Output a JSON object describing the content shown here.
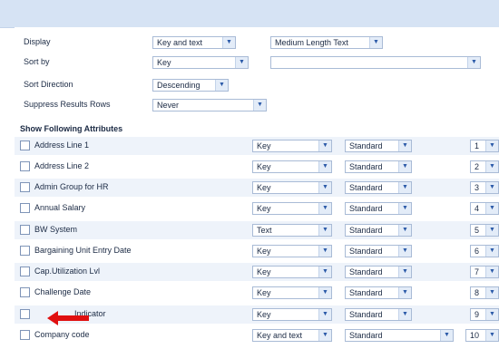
{
  "settings": {
    "display": {
      "label": "Display",
      "value1": "Key and text",
      "value2": "Medium Length Text"
    },
    "sort_by": {
      "label": "Sort by",
      "value1": "Key",
      "value2": ""
    },
    "sort_direction": {
      "label": "Sort Direction",
      "value": "Descending"
    },
    "suppress_results_rows": {
      "label": "Suppress Results Rows",
      "value": "Never"
    }
  },
  "attributes_section": {
    "title": "Show Following Attributes",
    "rows": [
      {
        "label": "Address Line 1",
        "display": "Key",
        "length": "Standard",
        "order": "1"
      },
      {
        "label": "Address Line 2",
        "display": "Key",
        "length": "Standard",
        "order": "2"
      },
      {
        "label": "Admin Group for HR",
        "display": "Key",
        "length": "Standard",
        "order": "3"
      },
      {
        "label": "Annual Salary",
        "display": "Key",
        "length": "Standard",
        "order": "4"
      },
      {
        "label": "BW System",
        "display": "Text",
        "length": "Standard",
        "order": "5"
      },
      {
        "label": "Bargaining Unit Entry Date",
        "display": "Key",
        "length": "Standard",
        "order": "6"
      },
      {
        "label": "Cap.Utilization Lvl",
        "display": "Key",
        "length": "Standard",
        "order": "7"
      },
      {
        "label": "Challenge Date",
        "display": "Key",
        "length": "Standard",
        "order": "8"
      },
      {
        "label": "Indicator",
        "display": "Key",
        "length": "Standard",
        "order": "9"
      },
      {
        "label": "Company code",
        "display": "Key and text",
        "length": "Standard",
        "order": "10"
      }
    ]
  },
  "icons": {
    "dropdown": "chevron-down-icon",
    "annotation": "red-arrow-icon"
  },
  "colors": {
    "header_bar": "#d6e3f4",
    "alt_row": "#eef3fa",
    "annotation_arrow": "#e01010",
    "dropdown_arrow": "#2b5aa8"
  }
}
